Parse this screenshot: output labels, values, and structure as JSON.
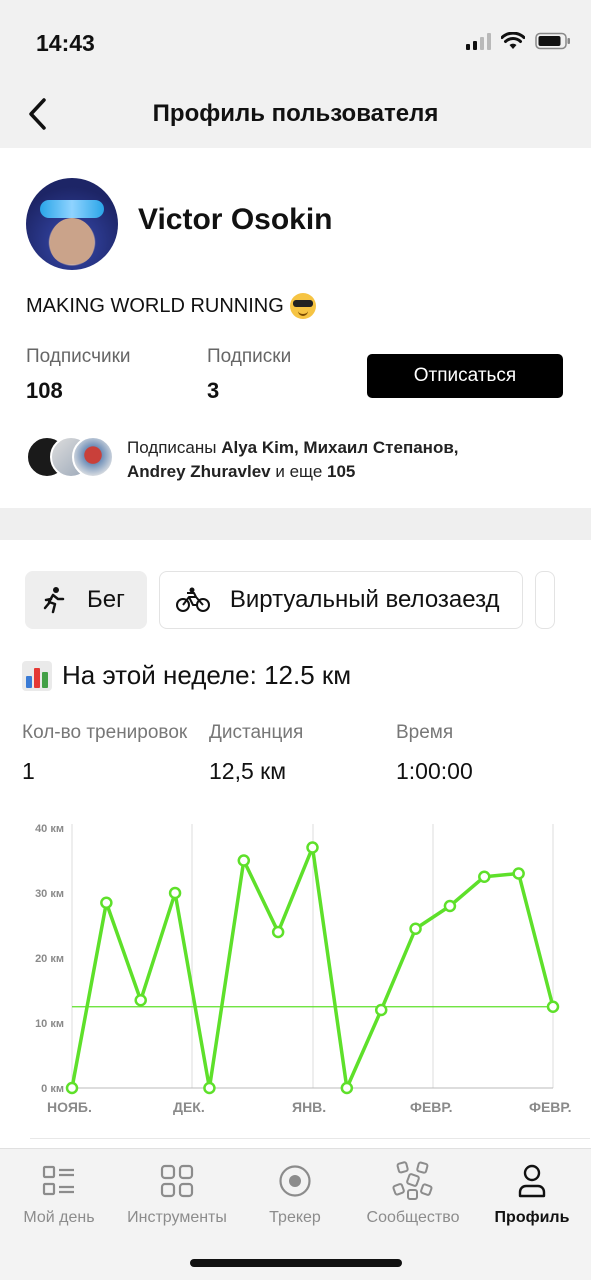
{
  "status_bar": {
    "time": "14:43"
  },
  "header": {
    "title": "Профиль пользователя"
  },
  "profile": {
    "name": "Victor Osokin",
    "bio": "MAKING WORLD RUNNING",
    "followers_label": "Подписчики",
    "followers_count": "108",
    "following_label": "Подписки",
    "following_count": "3",
    "unsubscribe_label": "Отписаться",
    "followed_by": {
      "prefix": "Подписаны",
      "names_1": "Alya Kim, Михаил Степанов,",
      "names_2": "Andrey Zhuravlev",
      "middle": "и еще",
      "more_count": "105"
    }
  },
  "activity": {
    "tabs": [
      {
        "label": "Бег",
        "icon": "running-icon",
        "active": true
      },
      {
        "label": "Виртуальный велозаезд",
        "icon": "cycling-icon",
        "active": false
      }
    ],
    "week_title": "На этой неделе: 12.5 км",
    "metrics": [
      {
        "label": "Кол-во тренировок",
        "value": "1"
      },
      {
        "label": "Дистанция",
        "value": "12,5 км"
      },
      {
        "label": "Время",
        "value": "1:00:00"
      }
    ]
  },
  "chart_data": {
    "type": "line",
    "x_tick_labels": [
      "НОЯБ.",
      "ДЕК.",
      "ЯНВ.",
      "ФЕВР.",
      "ФЕВР."
    ],
    "y_tick_labels": [
      "0 км",
      "10 км",
      "20 км",
      "30 км",
      "40 км"
    ],
    "ylim": [
      0,
      40
    ],
    "unit": "км",
    "series": [
      {
        "values": [
          0,
          28.5,
          13.5,
          30,
          0,
          35,
          24,
          37,
          0,
          12,
          24.5,
          28,
          32.5,
          33,
          12.5
        ]
      }
    ],
    "reference_line": 12.5,
    "colors": {
      "line": "#5ee02a",
      "grid": "#dddddd"
    }
  },
  "tab_bar": {
    "items": [
      {
        "label": "Мой день",
        "icon": "my-day-icon"
      },
      {
        "label": "Инструменты",
        "icon": "tools-icon"
      },
      {
        "label": "Трекер",
        "icon": "tracker-icon"
      },
      {
        "label": "Сообщество",
        "icon": "community-icon"
      },
      {
        "label": "Профиль",
        "icon": "profile-icon",
        "active": true
      }
    ]
  }
}
